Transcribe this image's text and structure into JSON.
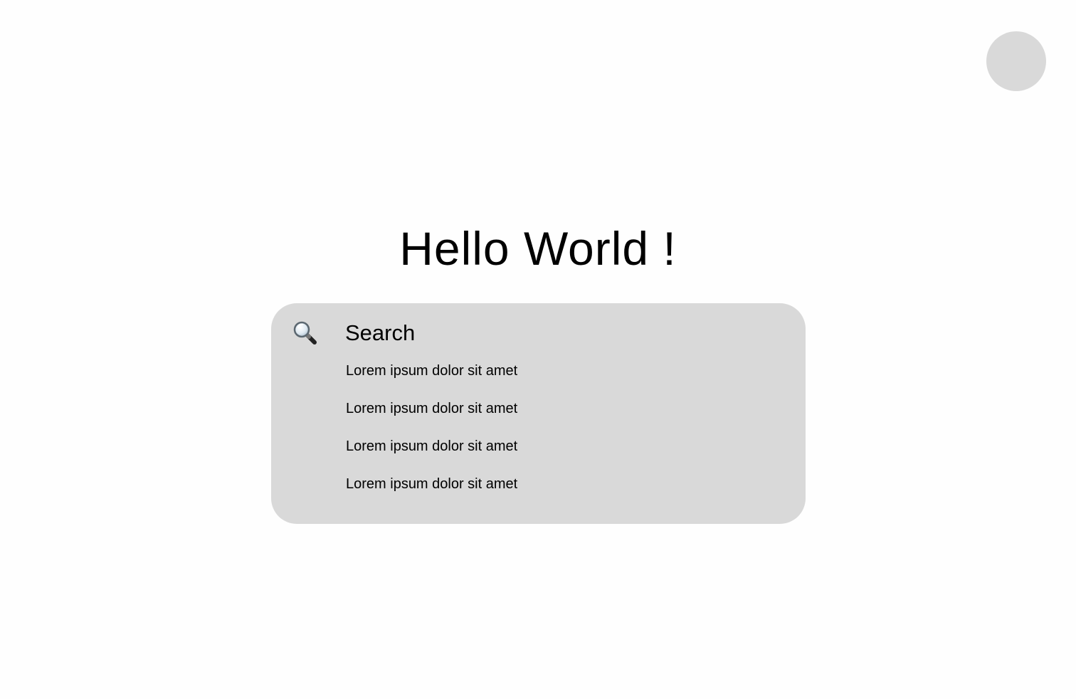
{
  "header": {
    "avatar_icon": "user-avatar-placeholder",
    "avatar_color": "#d9d9d9"
  },
  "main": {
    "title": "Hello World !",
    "search": {
      "icon": "magnifier-icon",
      "placeholder": "Search",
      "value": "",
      "panel_color": "#d9d9d9",
      "suggestions": [
        "Lorem ipsum dolor sit amet",
        "Lorem ipsum dolor sit amet",
        "Lorem ipsum dolor sit amet",
        "Lorem ipsum dolor sit amet"
      ]
    }
  }
}
